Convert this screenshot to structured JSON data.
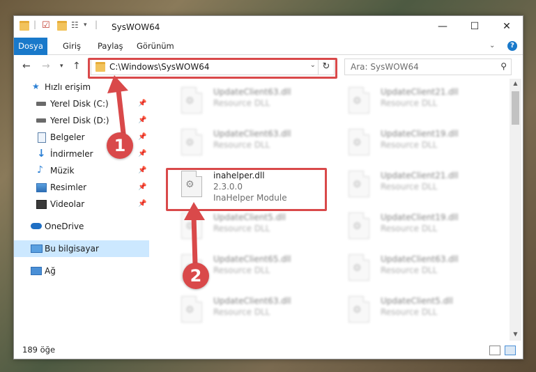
{
  "window": {
    "title": "SysWOW64",
    "controls": {
      "minimize": "—",
      "maximize": "☐",
      "close": "✕"
    }
  },
  "ribbon": {
    "tabs": [
      "Dosya",
      "Giriş",
      "Paylaş",
      "Görünüm"
    ],
    "help": "?"
  },
  "navigation": {
    "address": "C:\\Windows\\SysWOW64",
    "search_placeholder": "Ara: SysWOW64"
  },
  "sidebar": {
    "items": [
      {
        "label": "Hızlı erişim",
        "icon": "star-icon"
      },
      {
        "label": "Yerel Disk (C:)",
        "icon": "drive-icon",
        "pinned": true
      },
      {
        "label": "Yerel Disk (D:)",
        "icon": "drive-icon",
        "pinned": true
      },
      {
        "label": "Belgeler",
        "icon": "documents-icon",
        "pinned": true
      },
      {
        "label": "İndirmeler",
        "icon": "downloads-icon",
        "pinned": true
      },
      {
        "label": "Müzik",
        "icon": "music-icon",
        "pinned": true
      },
      {
        "label": "Resimler",
        "icon": "pictures-icon",
        "pinned": true
      },
      {
        "label": "Videolar",
        "icon": "videos-icon",
        "pinned": true
      },
      {
        "label": "OneDrive",
        "icon": "cloud-icon"
      },
      {
        "label": "Bu bilgisayar",
        "icon": "computer-icon",
        "selected": true
      },
      {
        "label": "Ağ",
        "icon": "network-icon"
      }
    ]
  },
  "files": {
    "left": [
      {
        "name": "UpdateClient63.dll",
        "desc": "Resource DLL"
      },
      {
        "name": "UpdateClient63.dll",
        "desc": "Resource DLL"
      },
      {
        "name": "inahelper.dll",
        "desc": "2.3.0.0",
        "desc2": "InaHelper Module"
      },
      {
        "name": "UpdateClient5.dll",
        "desc": "Resource DLL"
      },
      {
        "name": "UpdateClient65.dll",
        "desc": "Resource DLL"
      },
      {
        "name": "UpdateClient63.dll",
        "desc": "Resource DLL"
      }
    ],
    "right": [
      {
        "name": "UpdateClient21.dll",
        "desc": "Resource DLL"
      },
      {
        "name": "UpdateClient19.dll",
        "desc": "Resource DLL"
      },
      {
        "name": "UpdateClient21.dll",
        "desc": "Resource DLL"
      },
      {
        "name": "UpdateClient19.dll",
        "desc": "Resource DLL"
      },
      {
        "name": "UpdateClient63.dll",
        "desc": "Resource DLL"
      },
      {
        "name": "UpdateClient5.dll",
        "desc": "Resource DLL"
      }
    ]
  },
  "status": {
    "count": "189 öğe"
  },
  "callouts": [
    "1",
    "2"
  ],
  "colors": {
    "accent": "#1979ca",
    "highlight": "#d9494a",
    "selected": "#cce8ff"
  }
}
